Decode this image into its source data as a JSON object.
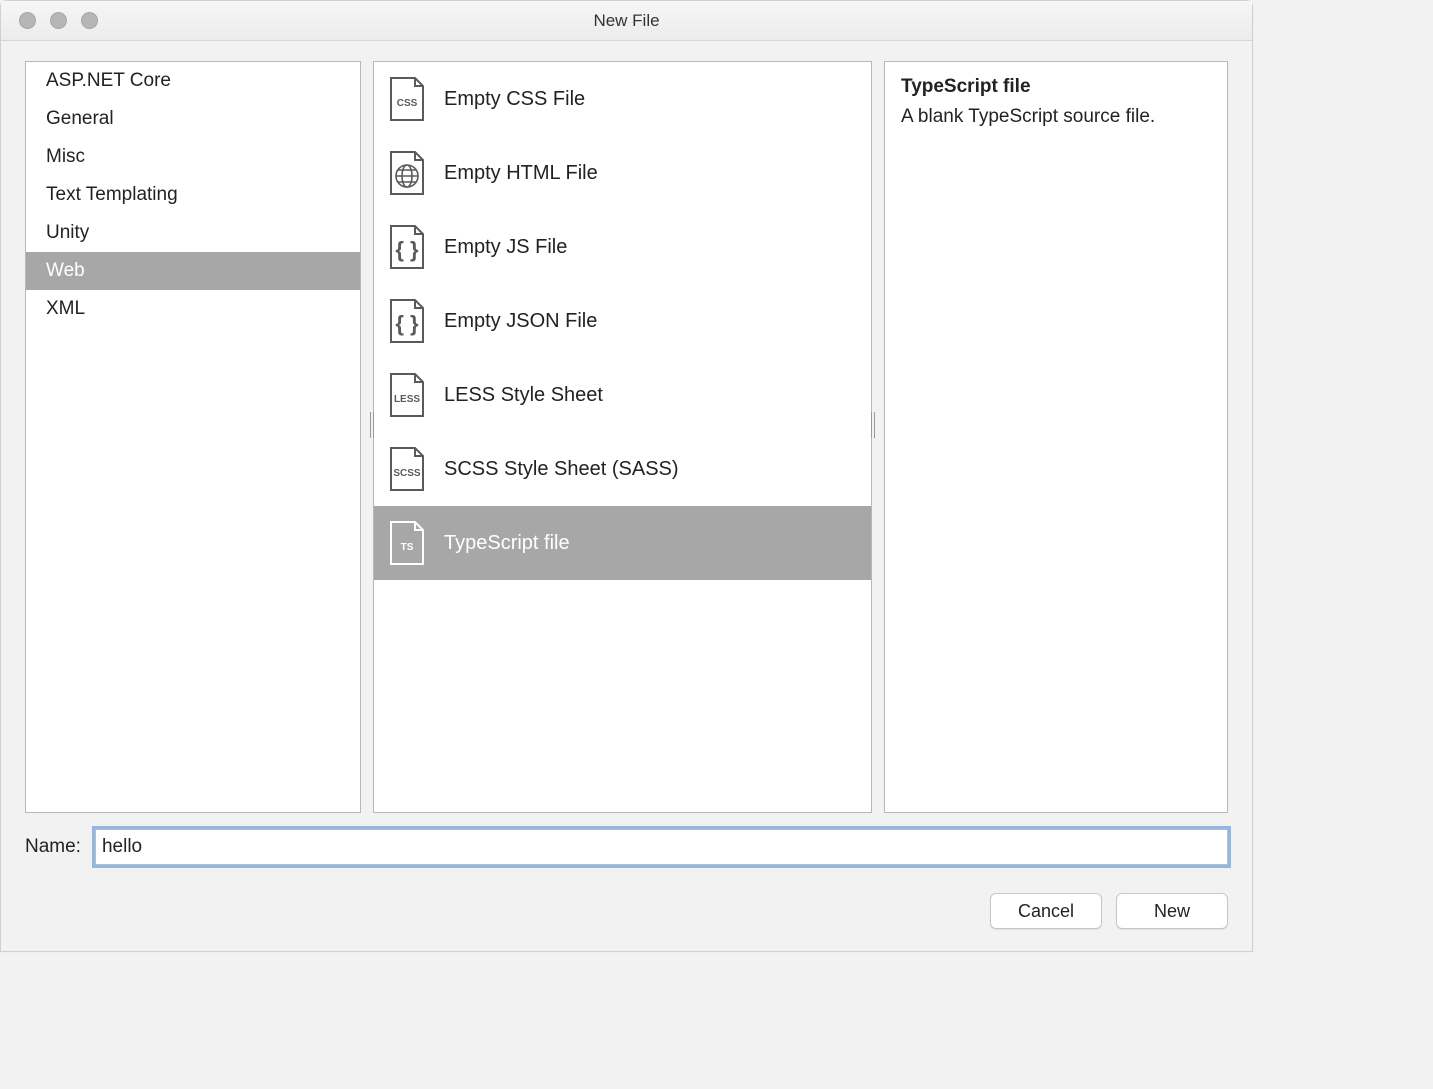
{
  "window": {
    "title": "New File"
  },
  "categories": {
    "items": [
      {
        "label": "ASP.NET Core",
        "selected": false
      },
      {
        "label": "General",
        "selected": false
      },
      {
        "label": "Misc",
        "selected": false
      },
      {
        "label": "Text Templating",
        "selected": false
      },
      {
        "label": "Unity",
        "selected": false
      },
      {
        "label": "Web",
        "selected": true
      },
      {
        "label": "XML",
        "selected": false
      }
    ]
  },
  "templates": {
    "items": [
      {
        "label": "Empty CSS File",
        "icon": "css",
        "selected": false
      },
      {
        "label": "Empty HTML File",
        "icon": "html",
        "selected": false
      },
      {
        "label": "Empty JS File",
        "icon": "braces",
        "selected": false
      },
      {
        "label": "Empty JSON File",
        "icon": "braces",
        "selected": false
      },
      {
        "label": "LESS Style Sheet",
        "icon": "less",
        "selected": false
      },
      {
        "label": "SCSS Style Sheet (SASS)",
        "icon": "scss",
        "selected": false
      },
      {
        "label": "TypeScript file",
        "icon": "ts",
        "selected": true
      }
    ]
  },
  "details": {
    "title": "TypeScript file",
    "description": "A blank TypeScript source file."
  },
  "form": {
    "name_label": "Name:",
    "name_value": "hello"
  },
  "buttons": {
    "cancel": "Cancel",
    "new": "New"
  }
}
